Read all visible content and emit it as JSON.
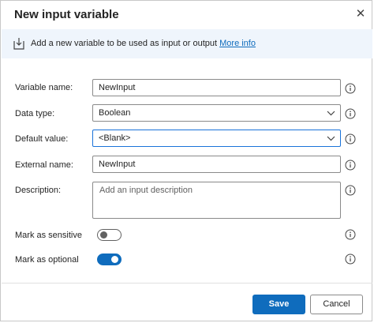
{
  "dialog": {
    "title": "New input variable",
    "close_icon": "close-icon"
  },
  "banner": {
    "icon": "download-icon",
    "text": "Add a new variable to be used as input or output",
    "link": "More info"
  },
  "form": {
    "variable_name": {
      "label": "Variable name:",
      "value": "NewInput"
    },
    "data_type": {
      "label": "Data type:",
      "value": "Boolean"
    },
    "default_value": {
      "label": "Default value:",
      "value": "<Blank>"
    },
    "external_name": {
      "label": "External name:",
      "value": "NewInput"
    },
    "description": {
      "label": "Description:",
      "placeholder": "Add an input description"
    },
    "mark_sensitive": {
      "label": "Mark as sensitive",
      "checked": false
    },
    "mark_optional": {
      "label": "Mark as optional",
      "checked": true
    }
  },
  "footer": {
    "save_label": "Save",
    "cancel_label": "Cancel"
  },
  "colors": {
    "accent": "#0f6cbd",
    "banner_bg": "#eff5fc",
    "focus_border": "#1a73d9"
  }
}
